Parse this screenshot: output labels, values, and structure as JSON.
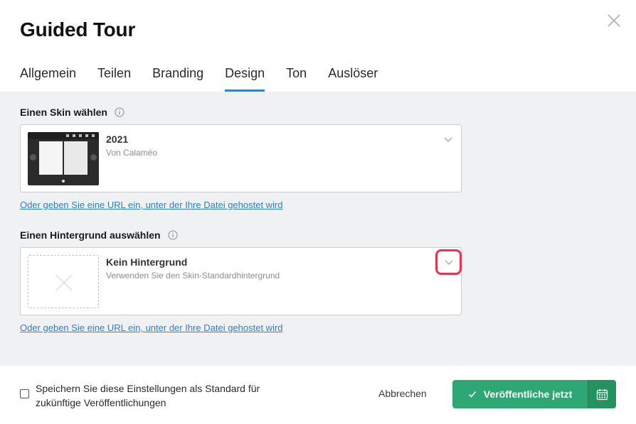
{
  "dialog": {
    "title": "Guided Tour"
  },
  "tabs": [
    {
      "label": "Allgemein"
    },
    {
      "label": "Teilen"
    },
    {
      "label": "Branding"
    },
    {
      "label": "Design",
      "active": true
    },
    {
      "label": "Ton"
    },
    {
      "label": "Auslöser"
    }
  ],
  "skin": {
    "label": "Einen Skin wählen",
    "title": "2021",
    "subtitle": "Von Calaméo",
    "url_link": "Oder geben Sie eine URL ein, unter der Ihre Datei gehostet wird"
  },
  "background": {
    "label": "Einen Hintergrund auswählen",
    "title": "Kein Hintergrund",
    "subtitle": "Verwenden Sie den Skin-Standardhintergrund",
    "url_link": "Oder geben Sie eine URL ein, unter der Ihre Datei gehostet wird"
  },
  "footer": {
    "checkbox_label": "Speichern Sie diese Einstellungen als Standard für zukünftige Veröffentlichungen",
    "checkbox_checked": false,
    "cancel_label": "Abbrechen",
    "publish_label": "Veröffentliche jetzt"
  },
  "colors": {
    "accent_tab": "#3b82c4",
    "publish_green": "#2fa774",
    "highlight_red": "#e8334f",
    "link_blue": "#2a7fd4"
  },
  "icons": [
    "close-icon",
    "info-icon",
    "chevron-down-icon",
    "empty-image-icon",
    "check-icon",
    "calendar-icon"
  ]
}
